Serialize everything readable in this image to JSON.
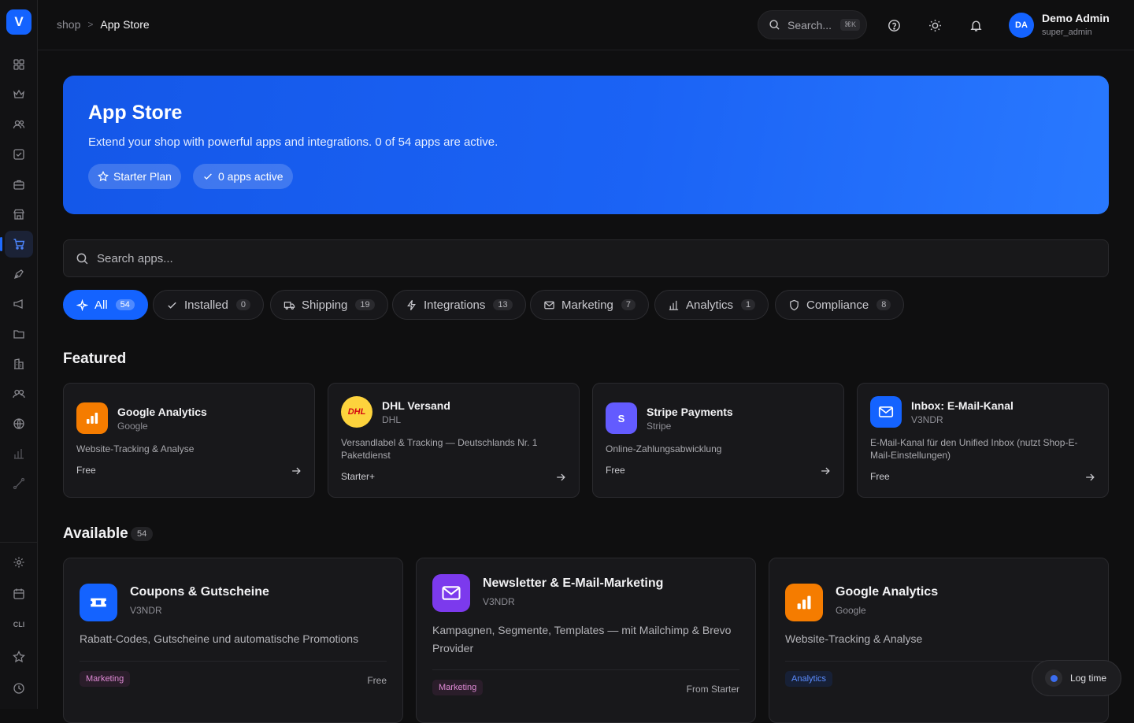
{
  "app": {
    "logo_letter": "V"
  },
  "breadcrumb": {
    "parent": "shop",
    "separator": ">",
    "current": "App Store"
  },
  "topbar": {
    "search_placeholder": "Search...",
    "search_shortcut": "⌘K",
    "user": {
      "initials": "DA",
      "name": "Demo Admin",
      "role": "super_admin"
    }
  },
  "sidebar": {
    "items": [
      {
        "icon": "dashboard-grid-icon"
      },
      {
        "icon": "crown-icon"
      },
      {
        "icon": "users-icon"
      },
      {
        "icon": "checklist-icon"
      },
      {
        "icon": "briefcase-icon"
      },
      {
        "icon": "storefront-icon"
      },
      {
        "icon": "shopping-cart-icon",
        "active": true
      },
      {
        "icon": "pen-nib-icon"
      },
      {
        "icon": "megaphone-icon"
      },
      {
        "icon": "folder-icon"
      },
      {
        "icon": "building-icon"
      },
      {
        "icon": "people-group-icon"
      },
      {
        "icon": "globe-icon"
      },
      {
        "icon": "bar-chart-icon"
      },
      {
        "icon": "route-icon"
      }
    ],
    "bottom_items": [
      {
        "icon": "settings-gear-icon"
      },
      {
        "icon": "calendar-icon"
      },
      {
        "label": "CLI"
      },
      {
        "icon": "star-icon"
      },
      {
        "icon": "clock-icon"
      }
    ]
  },
  "hero": {
    "title": "App Store",
    "subtitle": "Extend your shop with powerful apps and integrations. 0 of 54 apps are active.",
    "plan_pill": "Starter Plan",
    "active_pill": "0 apps active",
    "gradient_colors": [
      "#1457e8",
      "#2979ff"
    ]
  },
  "app_search": {
    "placeholder": "Search apps..."
  },
  "filters": [
    {
      "label": "All",
      "count": "54",
      "icon": "sparkles-icon",
      "active": true
    },
    {
      "label": "Installed",
      "count": "0",
      "icon": "check-icon"
    },
    {
      "label": "Shipping",
      "count": "19",
      "icon": "truck-icon"
    },
    {
      "label": "Integrations",
      "count": "13",
      "icon": "lightning-icon"
    },
    {
      "label": "Marketing",
      "count": "7",
      "icon": "mail-icon"
    },
    {
      "label": "Analytics",
      "count": "1",
      "icon": "bar-chart-icon"
    },
    {
      "label": "Compliance",
      "count": "8",
      "icon": "shield-icon"
    }
  ],
  "featured": {
    "title": "Featured",
    "apps": [
      {
        "name": "Google Analytics",
        "vendor": "Google",
        "description": "Website-Tracking & Analyse",
        "price": "Free",
        "icon": "bar-chart-icon",
        "color": "#f57c00"
      },
      {
        "name": "DHL Versand",
        "vendor": "DHL",
        "description": "Versandlabel & Tracking — Deutschlands Nr. 1 Paketdienst",
        "price": "Starter+",
        "icon": "dhl-logo-icon",
        "logo_text": "DHL",
        "color": "#fdd33d"
      },
      {
        "name": "Stripe Payments",
        "vendor": "Stripe",
        "description": "Online-Zahlungsabwicklung",
        "price": "Free",
        "icon": "stripe-logo-icon",
        "logo_text": "S",
        "color": "#635bff"
      },
      {
        "name": "Inbox: E-Mail-Kanal",
        "vendor": "V3NDR",
        "description": "E-Mail-Kanal für den Unified Inbox (nutzt Shop-E-Mail-Einstellungen)",
        "price": "Free",
        "icon": "mail-icon",
        "color": "#1463ff"
      }
    ]
  },
  "available": {
    "title": "Available",
    "count": "54",
    "apps": [
      {
        "name": "Coupons & Gutscheine",
        "vendor": "V3NDR",
        "description": "Rabatt-Codes, Gutscheine und automatische Promotions",
        "tag": "Marketing",
        "price": "Free",
        "icon": "ticket-icon",
        "color": "#1463ff"
      },
      {
        "name": "Newsletter & E-Mail-Marketing",
        "vendor": "V3NDR",
        "description": "Kampagnen, Segmente, Templates — mit Mailchimp & Brevo Provider",
        "tag": "Marketing",
        "price": "From Starter",
        "icon": "mail-icon",
        "color": "#7c3aed"
      },
      {
        "name": "Google Analytics",
        "vendor": "Google",
        "description": "Website-Tracking & Analyse",
        "tag": "Analytics",
        "price": "",
        "icon": "bar-chart-icon",
        "color": "#f57c00"
      }
    ]
  },
  "floating": {
    "log_time_label": "Log time"
  }
}
